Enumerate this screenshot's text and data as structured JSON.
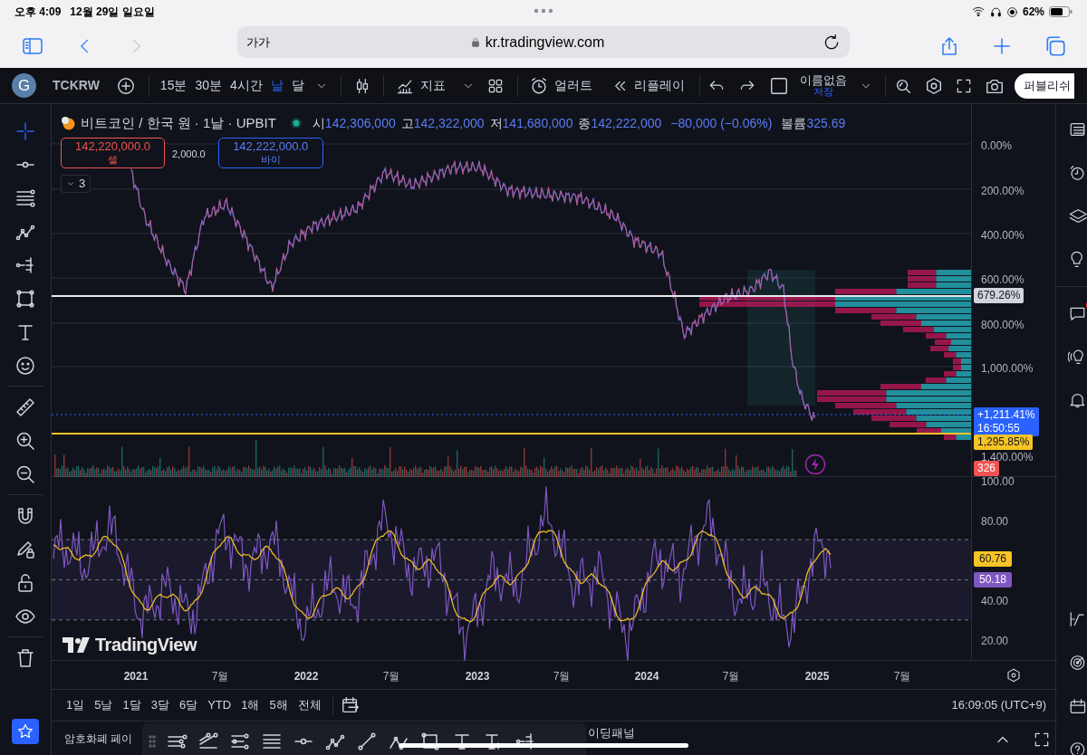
{
  "status_bar": {
    "time": "오후 4:09",
    "date": "12월 29일 일요일",
    "battery": "62%"
  },
  "browser": {
    "text_size": "가가",
    "url": "kr.tradingview.com"
  },
  "toolbar": {
    "avatar": "G",
    "symbol": "TCKRW",
    "intervals": [
      {
        "label": "15분",
        "selected": false
      },
      {
        "label": "30분",
        "selected": false
      },
      {
        "label": "4시간",
        "selected": false
      },
      {
        "label": "날",
        "selected": true
      },
      {
        "label": "달",
        "selected": false
      }
    ],
    "indicators": "지표",
    "alert": "얼러트",
    "replay": "리플레이",
    "layout_name": "이름없음",
    "layout_status": "저장",
    "publish": "퍼블리쉬"
  },
  "legend": {
    "title": "비트코인 / 한국 원 · 1날 · UPBIT",
    "values": [
      {
        "label": "시",
        "value": "142,306,000"
      },
      {
        "label": "고",
        "value": "142,322,000"
      },
      {
        "label": "저",
        "value": "141,680,000"
      },
      {
        "label": "종",
        "value": "142,222,000"
      }
    ],
    "change": "−80,000 (−0.06%)",
    "volume_label": "볼륨",
    "volume": "325.69"
  },
  "trade": {
    "sell_price": "142,220,000.0",
    "sell_label": "셀",
    "spread": "2,000.0",
    "buy_price": "142,222,000.0",
    "buy_label": "바이"
  },
  "collapsed_count": "3",
  "price_axis": {
    "labels": [
      "0.00%",
      "200.00%",
      "400.00%",
      "600.00%",
      "800.00%",
      "1,000.00%",
      "1,400.00%"
    ],
    "tags": [
      {
        "text": "679.26%",
        "color": "#d1d4dc"
      },
      {
        "text": "+1,211.41%",
        "subtext": "16:50:55",
        "color": "#2962ff"
      },
      {
        "text": "1,295.85%",
        "color": "#f7c325"
      },
      {
        "text": "326",
        "color": "#f05350"
      }
    ]
  },
  "rsi_axis": {
    "labels": [
      "100.00",
      "80.00",
      "40.00",
      "20.00"
    ],
    "tags": [
      {
        "text": "60.76",
        "color": "#f7c325"
      },
      {
        "text": "50.18",
        "color": "#7e57c2"
      }
    ]
  },
  "logo": "TradingView",
  "time_axis": [
    "2021",
    "7월",
    "2022",
    "7월",
    "2023",
    "7월",
    "2024",
    "7월",
    "2025",
    "7월"
  ],
  "ranges": [
    "1일",
    "5날",
    "1달",
    "3달",
    "6달",
    "YTD",
    "1해",
    "5해",
    "전체"
  ],
  "clock": "16:09:05 (UTC+9)",
  "bottom_panel": {
    "tab": "암호화폐 페이",
    "tab_2": "이딩패널"
  }
}
